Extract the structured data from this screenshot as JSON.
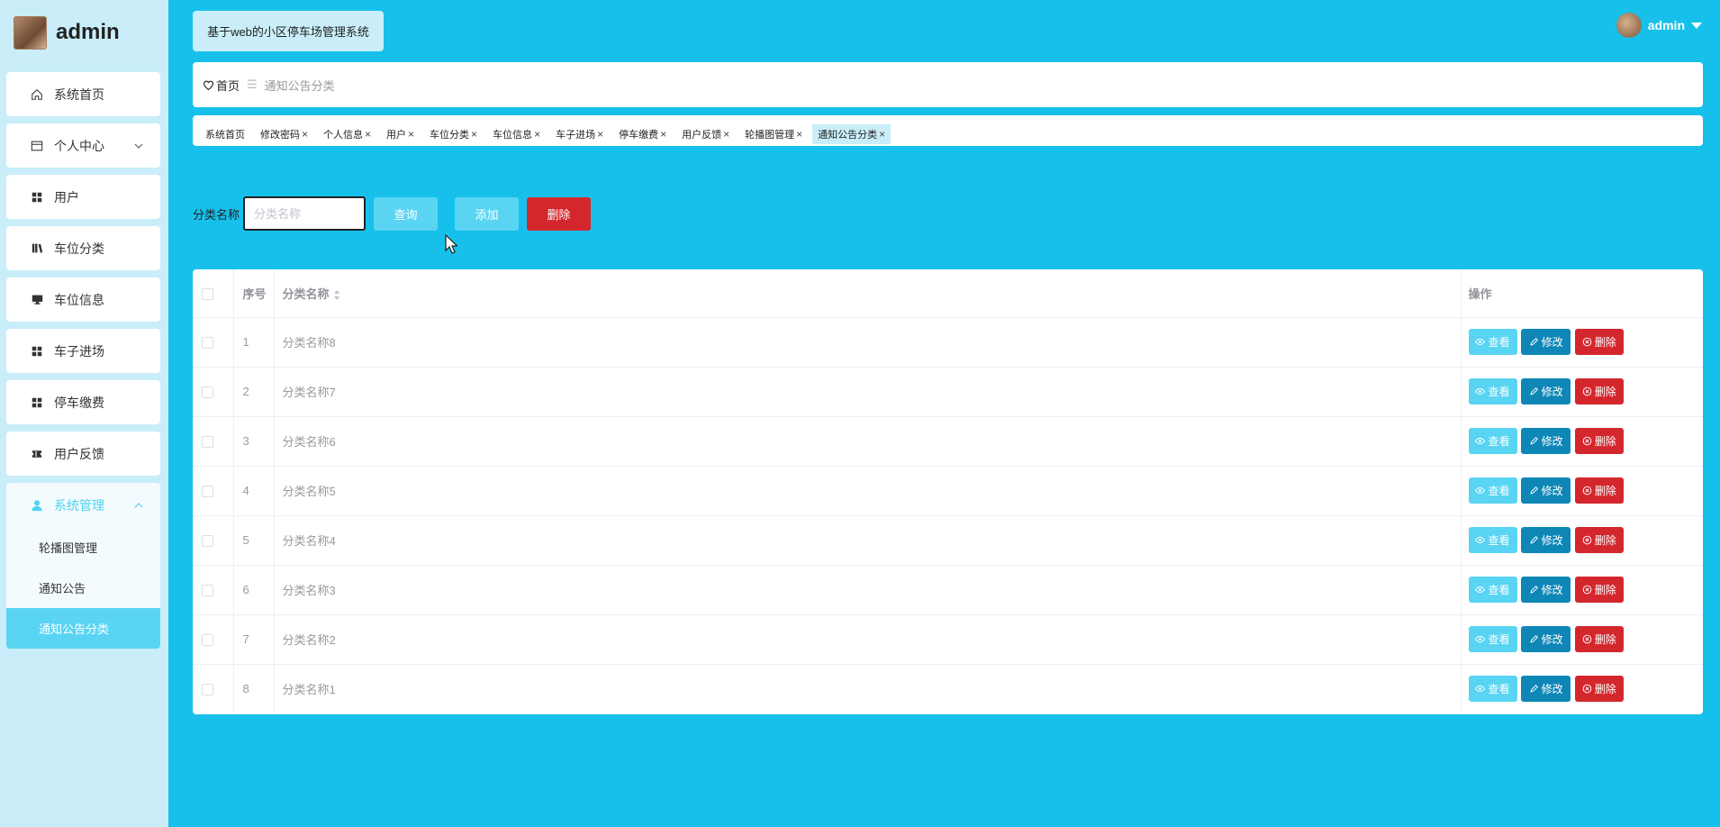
{
  "brand": {
    "name": "admin"
  },
  "header": {
    "system_title": "基于web的小区停车场管理系统",
    "username": "admin"
  },
  "sidebar": {
    "items": [
      {
        "label": "系统首页",
        "icon": "home-icon"
      },
      {
        "label": "个人中心",
        "icon": "window-icon"
      },
      {
        "label": "用户",
        "icon": "grid-icon"
      },
      {
        "label": "车位分类",
        "icon": "books-icon"
      },
      {
        "label": "车位信息",
        "icon": "monitor-icon"
      },
      {
        "label": "车子进场",
        "icon": "grid-icon"
      },
      {
        "label": "停车缴费",
        "icon": "grid-icon"
      },
      {
        "label": "用户反馈",
        "icon": "ticket-icon"
      }
    ],
    "group": {
      "label": "系统管理",
      "icon": "user-icon",
      "children": [
        "轮播图管理",
        "通知公告",
        "通知公告分类"
      ]
    }
  },
  "breadcrumb": {
    "home": "首页",
    "separator": "☰",
    "current": "通知公告分类"
  },
  "tags": [
    "系统首页",
    "修改密码",
    "个人信息",
    "用户",
    "车位分类",
    "车位信息",
    "车子进场",
    "停车缴费",
    "用户反馈",
    "轮播图管理",
    "通知公告分类"
  ],
  "search": {
    "label": "分类名称",
    "placeholder": "分类名称",
    "query_label": "查询",
    "add_label": "添加",
    "delete_label": "删除"
  },
  "table": {
    "headers": {
      "index": "序号",
      "name": "分类名称",
      "actions": "操作"
    },
    "rows": [
      {
        "index": "1",
        "name": "分类名称8"
      },
      {
        "index": "2",
        "name": "分类名称7"
      },
      {
        "index": "3",
        "name": "分类名称6"
      },
      {
        "index": "4",
        "name": "分类名称5"
      },
      {
        "index": "5",
        "name": "分类名称4"
      },
      {
        "index": "6",
        "name": "分类名称3"
      },
      {
        "index": "7",
        "name": "分类名称2"
      },
      {
        "index": "8",
        "name": "分类名称1"
      }
    ],
    "row_actions": {
      "view": "查看",
      "edit": "修改",
      "delete": "删除"
    }
  },
  "colors": {
    "background": "#17c0eb",
    "sidebar": "#c9eef9",
    "accent": "#5ad4f3",
    "edit": "#0e87b7",
    "danger": "#d4272d"
  }
}
